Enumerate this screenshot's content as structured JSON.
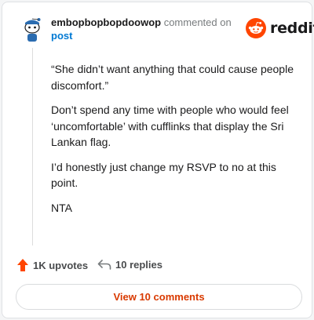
{
  "comment": {
    "username": "embopbopbopdoowop",
    "action_text": "commented on",
    "post_link_text": "post",
    "paragraphs": [
      "“She didn’t want anything that could cause people discomfort.”",
      "Don’t spend any time with people who would feel ‘uncomfortable’ with cufflinks that display the Sri Lankan flag.",
      "I’d honestly just change my RSVP to no at this point.",
      "NTA"
    ]
  },
  "brand": {
    "name": "reddit",
    "color": "#ff4500"
  },
  "footer": {
    "upvotes_label": "1K upvotes",
    "replies_label": "10 replies",
    "upvote_icon": "upvote-arrow-icon",
    "reply_icon": "reply-arrow-icon"
  },
  "view_comments_label": "View 10 comments",
  "colors": {
    "accent_link": "#0079d3",
    "button_text": "#d93a00",
    "upvote": "#ff4500"
  }
}
